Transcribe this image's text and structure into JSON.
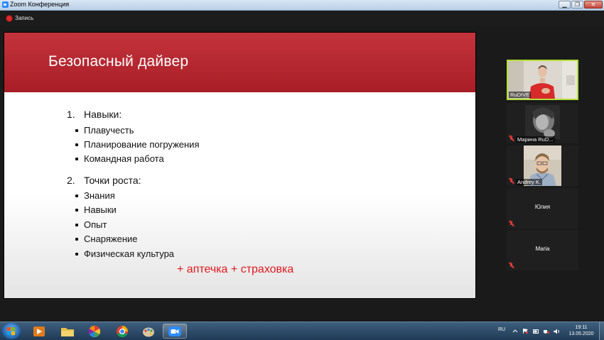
{
  "window": {
    "title": "Zoom Конференция",
    "controls": [
      "minimize",
      "restore",
      "close"
    ]
  },
  "recording": {
    "label": "Запись",
    "indicator_color": "#e02828"
  },
  "slide": {
    "title": "Безопасный дайвер",
    "header_color": "#b8262e",
    "sections": [
      {
        "number": "1.",
        "heading": "Навыки:",
        "bullets": [
          "Плавучесть",
          "Планирование погружения",
          "Командная работа"
        ]
      },
      {
        "number": "2.",
        "heading": "Точки роста:",
        "bullets": [
          "Знания",
          "Навыки",
          "Опыт",
          "Снаряжение",
          "Физическая культура"
        ]
      }
    ],
    "note": "+ аптечка + страховка",
    "note_color": "#e0191e"
  },
  "participants": [
    {
      "name": "RuDIVE",
      "video": true,
      "active_speaker": true,
      "muted": false
    },
    {
      "name": "Марина RuD...",
      "video": true,
      "active_speaker": false,
      "muted": true
    },
    {
      "name": "Andrey K.",
      "video": true,
      "active_speaker": false,
      "muted": true
    },
    {
      "name": "Юлия",
      "video": false,
      "active_speaker": false,
      "muted": true
    },
    {
      "name": "Maria",
      "video": false,
      "active_speaker": false,
      "muted": true
    }
  ],
  "taskbar": {
    "apps": [
      "explorer-icon",
      "media-player-icon",
      "folder-icon",
      "picasa-icon",
      "chrome-icon",
      "paint-icon",
      "zoom-icon"
    ],
    "running_app": "zoom-icon",
    "language": "RU",
    "time": "19:11",
    "date": "13.05.2020"
  }
}
